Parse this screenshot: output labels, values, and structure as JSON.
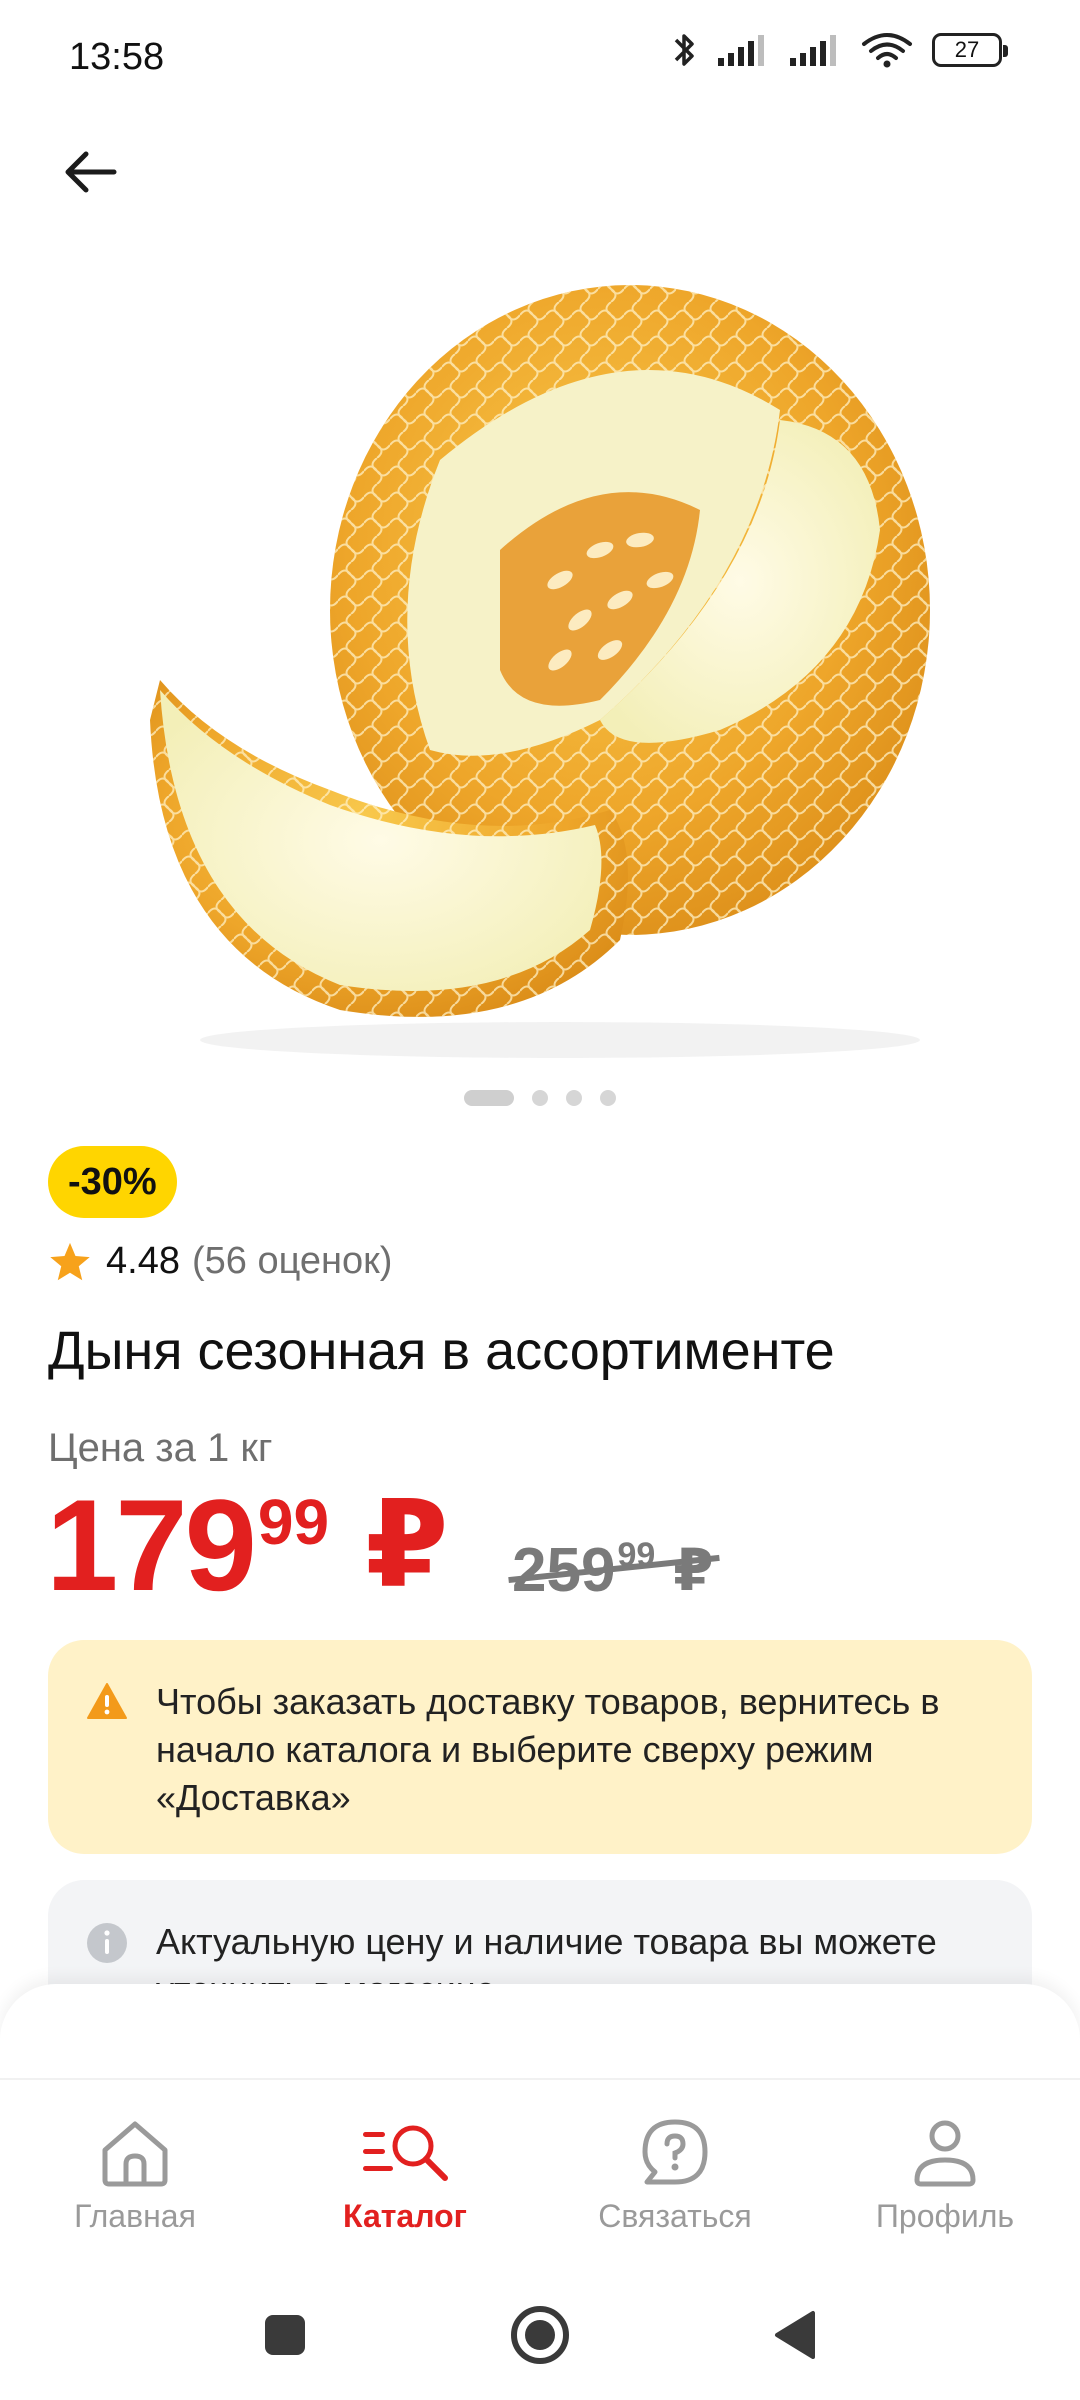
{
  "status_bar": {
    "time": "13:58",
    "battery": "27"
  },
  "product": {
    "discount": "-30%",
    "rating": "4.48",
    "rating_count": "(56 оценок)",
    "title": "Дыня сезонная в ассортименте",
    "price_caption": "Цена за 1 кг",
    "price_current_int": "179",
    "price_current_dec": "99",
    "price_old_int": "259",
    "price_old_dec": "99",
    "currency": "₽",
    "image_dots": 4,
    "active_image": 0
  },
  "notices": {
    "warning": "Чтобы заказать доставку товаров, вернитесь в начало каталога и выберите сверху режим «Доставка»",
    "info": "Актуальную цену и наличие товара вы можете уточнить в магазине"
  },
  "bottom_nav": {
    "items": [
      {
        "label": "Главная",
        "icon": "home-icon"
      },
      {
        "label": "Каталог",
        "icon": "catalog-search-icon"
      },
      {
        "label": "Связаться",
        "icon": "help-chat-icon"
      },
      {
        "label": "Профиль",
        "icon": "profile-icon"
      }
    ],
    "active_index": 1
  },
  "colors": {
    "accent": "#e2201f",
    "badge": "#ffd500",
    "warning_bg": "#fff2c8",
    "info_bg": "#f3f4f6"
  }
}
